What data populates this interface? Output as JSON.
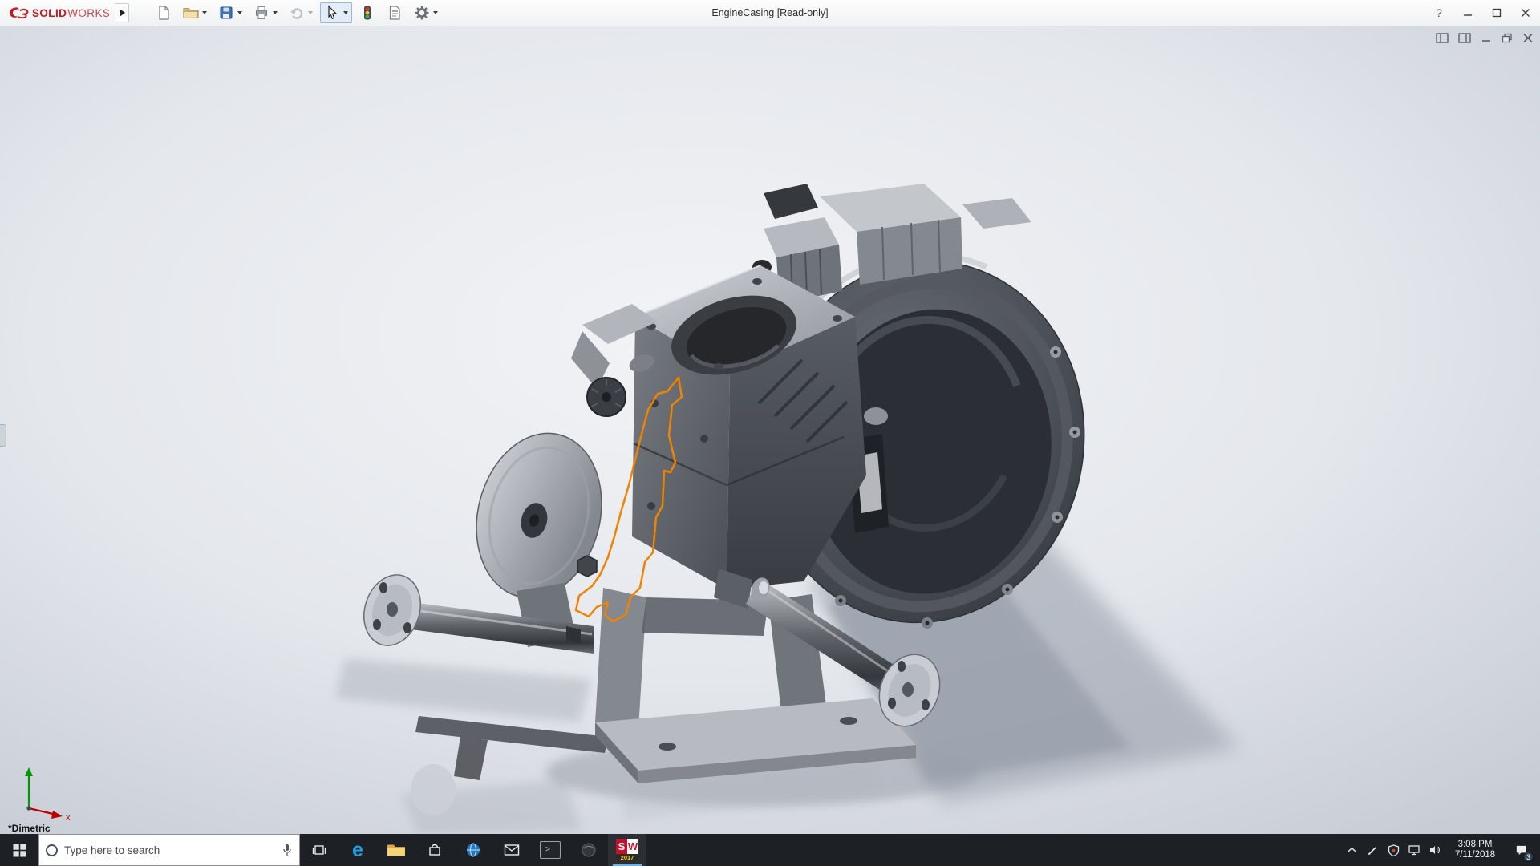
{
  "titlebar": {
    "brand": {
      "solid": "SOLID",
      "works": "WORKS"
    },
    "title": "EngineCasing [Read-only]",
    "help_glyph": "?"
  },
  "toolbar": {
    "icons": [
      "new-document",
      "open",
      "save",
      "print",
      "undo",
      "select",
      "rebuild",
      "file-properties",
      "options"
    ]
  },
  "viewport": {
    "view_label": "*Dimetric",
    "triad": {
      "x_label": "x"
    },
    "doc_window_controls": [
      "pane-left",
      "pane-right",
      "minimize",
      "restore",
      "close"
    ]
  },
  "taskbar": {
    "search": {
      "placeholder": "Type here to search"
    },
    "apps": {
      "list": [
        "task-view",
        "edge",
        "file-explorer",
        "store",
        "globe",
        "mail",
        "terminal",
        "sphere-app",
        "solidworks-2017"
      ],
      "edge_glyph": "e",
      "terminal_glyph": ">_",
      "solidworks": {
        "s": "S",
        "w": "W",
        "year": "2017"
      }
    },
    "tray": {
      "time": "3:08 PM",
      "date": "7/11/2018",
      "notification_count": "3"
    }
  },
  "colors": {
    "sketch_orange": "#f08300",
    "taskbar_bg": "#1d2024",
    "solidworks_red": "#c8102e",
    "edge_blue": "#1ea0e6",
    "folder_yellow": "#f6d37a",
    "triad_x_red": "#c00000",
    "triad_y_green": "#009a00"
  }
}
